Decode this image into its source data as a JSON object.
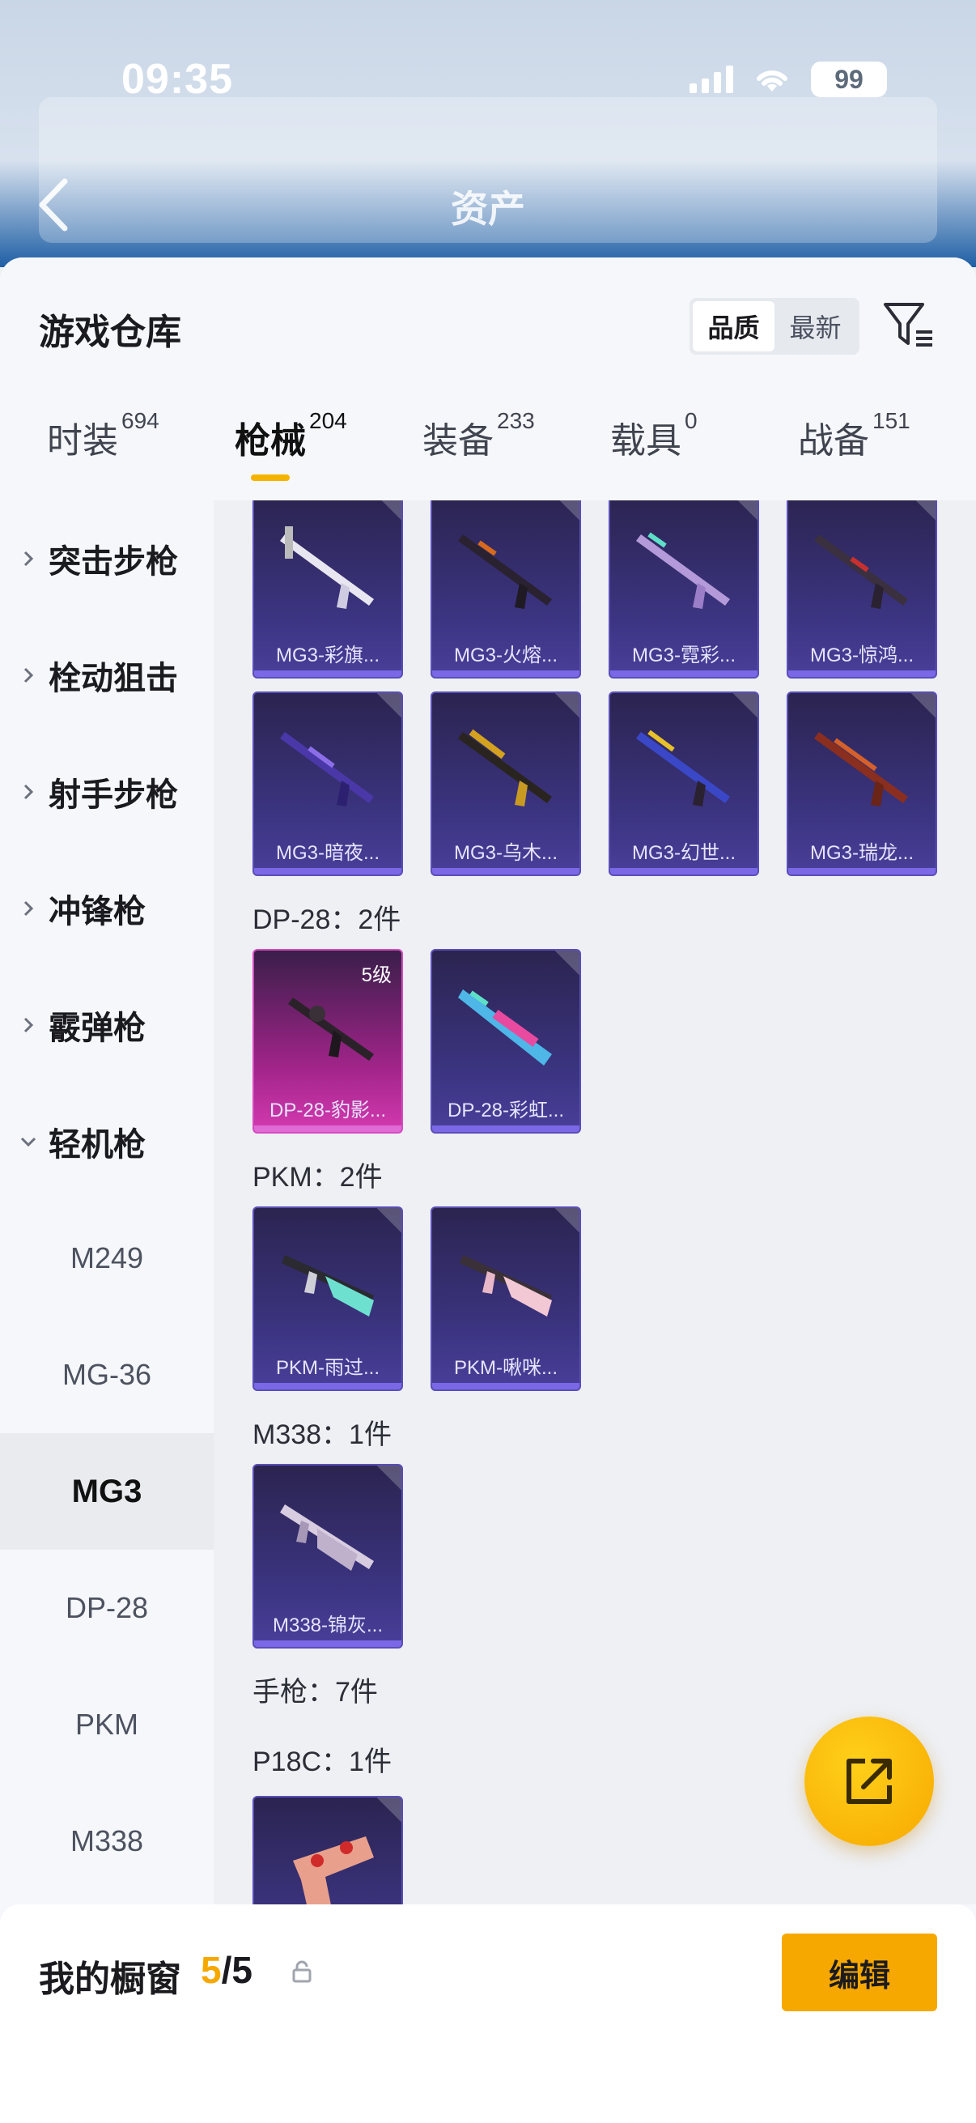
{
  "status": {
    "time": "09:35",
    "battery": "99"
  },
  "nav": {
    "title": "资产"
  },
  "sheet": {
    "title": "游戏仓库",
    "sort": {
      "quality": "品质",
      "latest": "最新"
    }
  },
  "tabs": [
    {
      "label": "时装",
      "count": "694"
    },
    {
      "label": "枪械",
      "count": "204"
    },
    {
      "label": "装备",
      "count": "233"
    },
    {
      "label": "载具",
      "count": "0"
    },
    {
      "label": "战备",
      "count": "151"
    }
  ],
  "categories": [
    {
      "label": "突击步枪"
    },
    {
      "label": "栓动狙击"
    },
    {
      "label": "射手步枪"
    },
    {
      "label": "冲锋枪"
    },
    {
      "label": "霰弹枪"
    },
    {
      "label": "轻机枪"
    }
  ],
  "subcategories": [
    {
      "label": "M249"
    },
    {
      "label": "MG-36"
    },
    {
      "label": "MG3"
    },
    {
      "label": "DP-28"
    },
    {
      "label": "PKM"
    },
    {
      "label": "M338"
    }
  ],
  "sections": {
    "dp28": "DP-28：2件",
    "pkm": "PKM：2件",
    "m338": "M338：1件",
    "pistol": "手枪：7件",
    "p18c": "P18C：1件"
  },
  "cards": {
    "mg3": [
      {
        "name": "MG3-彩旗..."
      },
      {
        "name": "MG3-火熔..."
      },
      {
        "name": "MG3-霓彩..."
      },
      {
        "name": "MG3-惊鸿..."
      },
      {
        "name": "MG3-暗夜..."
      },
      {
        "name": "MG3-乌木..."
      },
      {
        "name": "MG3-幻世..."
      },
      {
        "name": "MG3-瑞龙..."
      }
    ],
    "dp28": [
      {
        "name": "DP-28-豹影...",
        "level": "5级"
      },
      {
        "name": "DP-28-彩虹..."
      }
    ],
    "pkm": [
      {
        "name": "PKM-雨过..."
      },
      {
        "name": "PKM-啾咪..."
      }
    ],
    "m338": [
      {
        "name": "M338-锦灰..."
      }
    ]
  },
  "showcase": {
    "title": "我的橱窗",
    "current": "5",
    "total": "/5",
    "edit": "编辑"
  },
  "colors": {
    "accent": "#f7a800",
    "card_purple": "#3c3583",
    "card_pink": "#d43ab0"
  }
}
